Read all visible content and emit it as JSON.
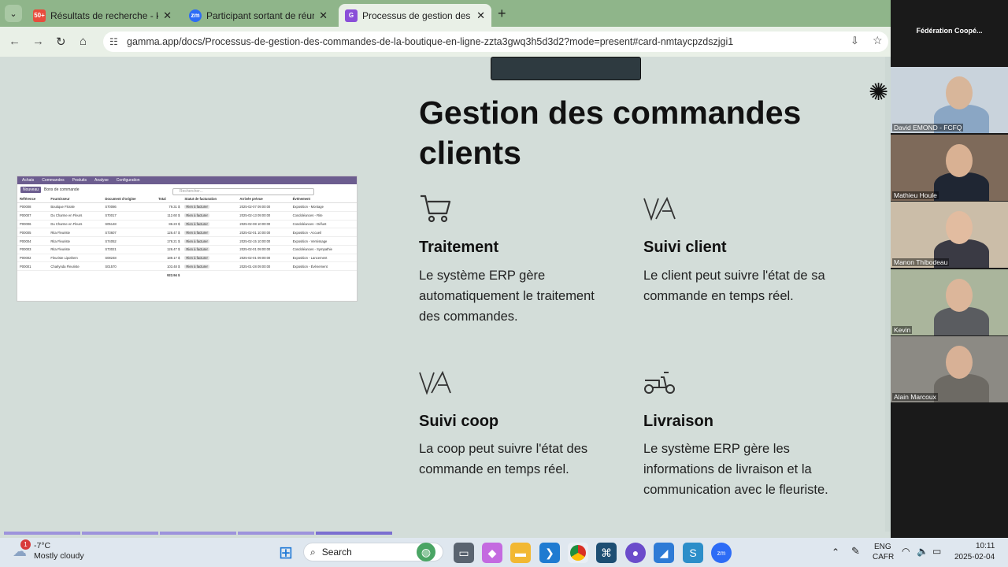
{
  "browser": {
    "tabs": [
      {
        "title": "Résultats de recherche - ktherm",
        "favicon_label": "50+",
        "favicon_color": "#e84c3d",
        "active": false
      },
      {
        "title": "Participant sortant de réunion",
        "favicon_label": "zm",
        "favicon_color": "#2d6cf6",
        "active": false
      },
      {
        "title": "Processus de gestion des comm",
        "favicon_label": "G",
        "favicon_color": "#8a4fd8",
        "active": true
      }
    ],
    "new_tab_icon": "+",
    "url": "gamma.app/docs/Processus-de-gestion-des-commandes-de-la-boutique-en-ligne-zzta3gwq3h5d3d2?mode=present#card-nmtaycpzdszjgi1"
  },
  "slide": {
    "title": "Gestion des commandes clients",
    "cards": [
      {
        "icon": "shopping-cart-icon",
        "glyph": "🛒",
        "heading": "Traitement",
        "text": "Le système ERP gère automatiquement le traitement des commandes."
      },
      {
        "icon": "va-logo-icon",
        "glyph": "V/A",
        "heading": "Suivi client",
        "text": "Le client peut suivre l'état de sa commande en temps réel."
      },
      {
        "icon": "va-logo-icon",
        "glyph": "V/A",
        "heading": "Suivi coop",
        "text": "La coop peut suivre l'état des commande en temps réel."
      },
      {
        "icon": "scooter-icon",
        "glyph": "🛵",
        "heading": "Livraison",
        "text": "Le système ERP gère les informations de livraison et la communication avec le fleuriste."
      }
    ],
    "progress": {
      "total_segments": 5,
      "active_segment": 5
    }
  },
  "erp": {
    "menu": [
      "Achats",
      "Commandes",
      "Produits",
      "Analyse",
      "Configuration"
    ],
    "new_button": "Nouveau",
    "breadcrumb": "Bons de commande",
    "search_placeholder": "Rechercher...",
    "columns": [
      "Référence",
      "Fournisseur",
      "Document d'origine",
      "Total",
      "Statut de facturation",
      "Arrivée prévue",
      "Événement"
    ],
    "rows": [
      [
        "P00008",
        "Boutique Florale",
        "S70086",
        "79.31 $",
        "Rien à facturer",
        "2025-02-07 09:00:00",
        "Exposition - Montage"
      ],
      [
        "P00007",
        "Du Charme en Fleurs",
        "S70017",
        "112.60 $",
        "Rien à facturer",
        "2025-02-13 09:00:00",
        "Condoléances - Rite"
      ],
      [
        "P00006",
        "Du Charme en Fleurs",
        "S05148",
        "86.23 $",
        "Rien à facturer",
        "2025-02-08 10:00:00",
        "Condoléances - Défunt"
      ],
      [
        "P00005",
        "Rita Fleuriste",
        "S73607",
        "126.47 $",
        "Rien à facturer",
        "2025-02-01 10:00:00",
        "Exposition - Accueil"
      ],
      [
        "P00004",
        "Rita Fleuriste",
        "S74052",
        "178.21 $",
        "Rien à facturer",
        "2025-02-15 10:00:00",
        "Exposition - Vernissage"
      ],
      [
        "P00003",
        "Rita Fleuriste",
        "S73021",
        "126.47 $",
        "Rien à facturer",
        "2025-02-01 09:00:00",
        "Condoléances - Sympathie"
      ],
      [
        "P00002",
        "Fleuriste Lipothem",
        "S08248",
        "189.17 $",
        "Rien à facturer",
        "2025-02-01 09:00:00",
        "Exposition - Lancement"
      ],
      [
        "P00001",
        "Charlynda Fleuriste",
        "S01570",
        "103.48 $",
        "Rien à facturer",
        "2025-01-28 09:00:00",
        "Exposition - Évènement"
      ]
    ],
    "grand_total": "922.94 $"
  },
  "zoom": {
    "meeting_name": "Fédération Coopé...",
    "participants": [
      {
        "name": "David EMOND - FCFQ",
        "bg": "#c9d3dc",
        "skin": "#d8b69a",
        "shirt": "#8aa6c4"
      },
      {
        "name": "Mathieu Houle",
        "bg": "#7e6a5a",
        "skin": "#d9b193",
        "shirt": "#1f2633"
      },
      {
        "name": "Manon Thibodeau",
        "bg": "#cbbda8",
        "skin": "#e2bca0",
        "shirt": "#3a3a44"
      },
      {
        "name": "Kevin",
        "bg": "#aab59c",
        "skin": "#dcb69a",
        "shirt": "#5a5c60"
      },
      {
        "name": "Alain Marcoux",
        "bg": "#8c8a84",
        "skin": "#d8b196",
        "shirt": "#6d6a64"
      }
    ]
  },
  "taskbar": {
    "weather_temp": "-7°C",
    "weather_desc": "Mostly cloudy",
    "weather_badge": "1",
    "search_label": "Search",
    "lang": "ENG",
    "locale": "CAFR",
    "time": "10:11",
    "date": "2025-02-04"
  }
}
